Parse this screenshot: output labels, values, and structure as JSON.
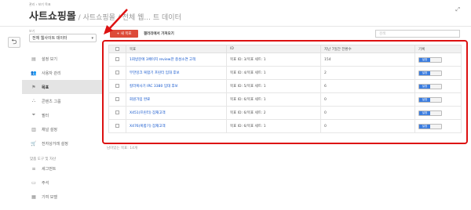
{
  "header": {
    "crumb": "관리 › 보기 목표",
    "title_main": "사트쇼핑몰",
    "title_rest": " / 사트쇼핑몰 / 전체 웹... 트 데이터"
  },
  "sidebar": {
    "view_label": "보기",
    "view_selected": "전체 웹사이트 데이터",
    "items": [
      {
        "label": "설정 보기",
        "icon": "view-settings-icon",
        "glyph": "▤"
      },
      {
        "label": "사용자 관리",
        "icon": "users-icon",
        "glyph": "👥"
      },
      {
        "label": "목표",
        "icon": "flag-icon",
        "glyph": "⚑"
      },
      {
        "label": "콘텐츠 그룹",
        "icon": "content-group-icon",
        "glyph": "⛬"
      },
      {
        "label": "필터",
        "icon": "filter-icon",
        "glyph": "⏷"
      },
      {
        "label": "채널 설정",
        "icon": "channel-icon",
        "glyph": "▥"
      },
      {
        "label": "전자상거래 설정",
        "icon": "cart-icon",
        "glyph": "🛒"
      }
    ],
    "section_label": "맞춤 도구 및 자산",
    "section_items": [
      {
        "label": "세그먼트",
        "icon": "segment-icon",
        "glyph": "≡"
      },
      {
        "label": "주석",
        "icon": "annotation-icon",
        "glyph": "▭"
      },
      {
        "label": "기여 모델",
        "icon": "attribution-icon",
        "glyph": "▦"
      }
    ]
  },
  "toolbar": {
    "add_label": "+ 새 목표",
    "import_label": "갤러리에서 가져오기",
    "search_placeholder": "검색"
  },
  "table": {
    "headers": [
      "목표",
      "ID",
      "지난 7일간 전환수",
      "기록"
    ],
    "rows": [
      {
        "goal": "1회방문에 3페이지 review한 충성소연 고객",
        "id": "목표 ID: 3/목표 세트: 1",
        "conv": "154",
        "rec": "설정"
      },
      {
        "goal": "무한잉크 복합기 프린터 임대 후보",
        "id": "목표 ID: 4/목표 세트: 1",
        "conv": "2",
        "rec": "설정"
      },
      {
        "goal": "칼라복사기 IRC 3380 임대 후보",
        "id": "목표 ID: 5/목표 세트: 1",
        "conv": "6",
        "rec": "설정"
      },
      {
        "goal": "회원가입 완료",
        "id": "목표 ID: 6/목표 세트: 1",
        "conv": "0",
        "rec": "설정"
      },
      {
        "goal": "X451(프린터) 잠재고객",
        "id": "목표 ID: 6/목표 세트: 2",
        "conv": "0",
        "rec": "설정"
      },
      {
        "goal": "X476(복합기) 잠재고객",
        "id": "목표 ID: 6/목표 세트: 1",
        "conv": "0",
        "rec": "설정"
      }
    ]
  },
  "footnote": "남아있는 목표: 14개",
  "colors": {
    "accent": "#dd4b39",
    "highlight": "#d11111",
    "link": "#1155cc",
    "toggle_on": "#3b7de0"
  }
}
